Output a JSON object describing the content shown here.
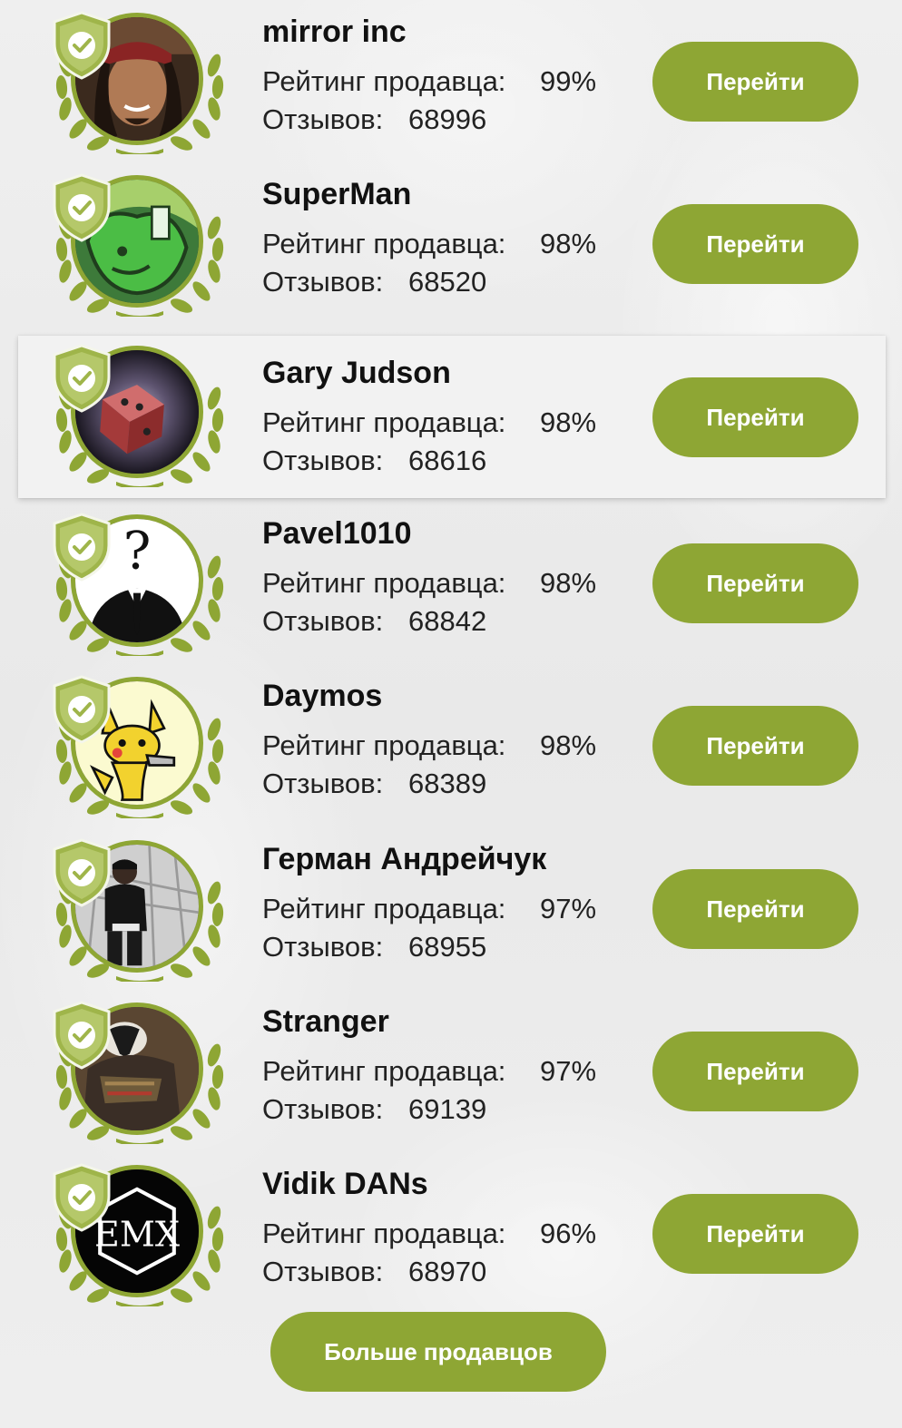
{
  "sellers": [
    {
      "name": "mirror inc",
      "rating_label": "Рейтинг продавца:",
      "rating": "99%",
      "reviews_label": "Отзывов:",
      "reviews": "68996",
      "button": "Перейти",
      "avatar": "pirate-photo",
      "highlighted": false
    },
    {
      "name": "SuperMan",
      "rating_label": "Рейтинг продавца:",
      "rating": "98%",
      "reviews_label": "Отзывов:",
      "reviews": "68520",
      "button": "Перейти",
      "avatar": "green-cartoon",
      "highlighted": false
    },
    {
      "name": "Gary Judson",
      "rating_label": "Рейтинг продавца:",
      "rating": "98%",
      "reviews_label": "Отзывов:",
      "reviews": "68616",
      "button": "Перейти",
      "avatar": "red-dice",
      "highlighted": true
    },
    {
      "name": "Pavel1010",
      "rating_label": "Рейтинг продавца:",
      "rating": "98%",
      "reviews_label": "Отзывов:",
      "reviews": "68842",
      "button": "Перейти",
      "avatar": "question-suit",
      "highlighted": false
    },
    {
      "name": "Daymos",
      "rating_label": "Рейтинг продавца:",
      "rating": "98%",
      "reviews_label": "Отзывов:",
      "reviews": "68389",
      "button": "Перейти",
      "avatar": "yellow-cartoon",
      "highlighted": false
    },
    {
      "name": "Герман Андрейчук",
      "rating_label": "Рейтинг продавца:",
      "rating": "97%",
      "reviews_label": "Отзывов:",
      "reviews": "68955",
      "button": "Перейти",
      "avatar": "person-photo",
      "highlighted": false
    },
    {
      "name": "Stranger",
      "rating_label": "Рейтинг продавца:",
      "rating": "97%",
      "reviews_label": "Отзывов:",
      "reviews": "69139",
      "button": "Перейти",
      "avatar": "badger-photo",
      "highlighted": false
    },
    {
      "name": "Vidik DANs",
      "rating_label": "Рейтинг продавца:",
      "rating": "96%",
      "reviews_label": "Отзывов:",
      "reviews": "68970",
      "button": "Перейти",
      "avatar": "emx-logo",
      "highlighted": false
    }
  ],
  "more_button": "Больше продавцов",
  "colors": {
    "accent": "#8ea634",
    "shield": "#9fb54a",
    "text": "#111111"
  }
}
